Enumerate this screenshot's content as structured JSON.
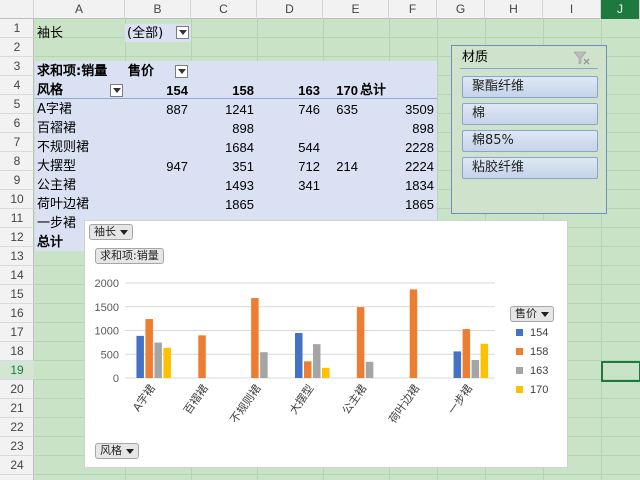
{
  "column_headers": [
    "A",
    "B",
    "C",
    "D",
    "E",
    "F",
    "G",
    "H",
    "I",
    "J"
  ],
  "row_headers": [
    "1",
    "2",
    "3",
    "4",
    "5",
    "6",
    "7",
    "8",
    "9",
    "10",
    "11",
    "12",
    "13",
    "14",
    "15",
    "16",
    "17",
    "18",
    "19",
    "20",
    "21",
    "22",
    "23",
    "24"
  ],
  "selected_row": "19",
  "selected_column": "J",
  "filter": {
    "label": "袖长",
    "value": "(全部)"
  },
  "pivot": {
    "value_field": "求和项:销量",
    "column_field": "售价",
    "row_field": "风格",
    "columns": [
      "154",
      "158",
      "163",
      "170",
      "总计"
    ],
    "rows": [
      {
        "label": "A字裙",
        "values": [
          "887",
          "1241",
          "746",
          "635",
          "3509"
        ]
      },
      {
        "label": "百褶裙",
        "values": [
          "",
          "898",
          "",
          "",
          "898"
        ]
      },
      {
        "label": "不规则裙",
        "values": [
          "",
          "1684",
          "544",
          "",
          "2228"
        ]
      },
      {
        "label": "大摆型",
        "values": [
          "947",
          "351",
          "712",
          "214",
          "2224"
        ]
      },
      {
        "label": "公主裙",
        "values": [
          "",
          "1493",
          "341",
          "",
          "1834"
        ]
      },
      {
        "label": "荷叶边裙",
        "values": [
          "",
          "1865",
          "",
          "",
          "1865"
        ]
      },
      {
        "label": "一步裙",
        "values": [
          "",
          "",
          "",
          "",
          ""
        ]
      }
    ],
    "total_label": "总计"
  },
  "slicer": {
    "title": "材质",
    "items": [
      "聚酯纤维",
      "棉",
      "棉85%",
      "粘胶纤维"
    ]
  },
  "chart_data": {
    "type": "bar",
    "categories": [
      "A字裙",
      "百褶裙",
      "不规则裙",
      "大摆型",
      "公主裙",
      "荷叶边裙",
      "一步裙"
    ],
    "series": [
      {
        "name": "154",
        "color": "#4472c4",
        "values": [
          887,
          null,
          null,
          947,
          null,
          null,
          560
        ]
      },
      {
        "name": "158",
        "color": "#ed7d31",
        "values": [
          1241,
          898,
          1684,
          351,
          1493,
          1865,
          1030
        ]
      },
      {
        "name": "163",
        "color": "#a5a5a5",
        "values": [
          746,
          null,
          544,
          712,
          341,
          null,
          380
        ]
      },
      {
        "name": "170",
        "color": "#ffc000",
        "values": [
          635,
          null,
          null,
          214,
          null,
          null,
          720
        ]
      }
    ],
    "yticks": [
      "0",
      "500",
      "1000",
      "1500",
      "2000"
    ],
    "ylim": [
      0,
      2000
    ],
    "grid": true,
    "legend_position": "right",
    "filter_button": "袖长",
    "value_button": "求和项:销量",
    "legend_button": "售价",
    "axis_button": "风格"
  }
}
